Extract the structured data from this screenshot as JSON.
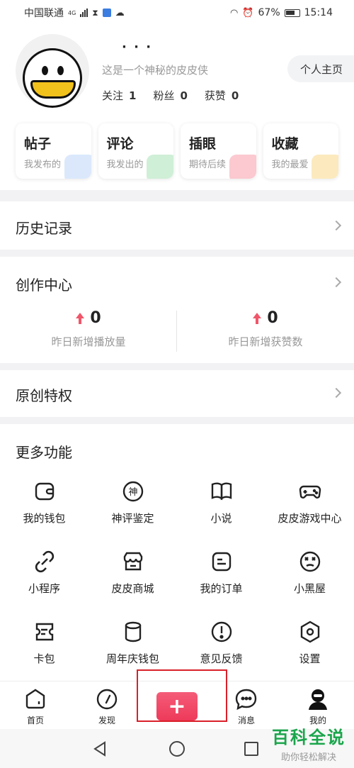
{
  "statusbar": {
    "carrier": "中国联通",
    "network_badge": "4G",
    "battery_pct": "67%",
    "time": "15:14"
  },
  "profile": {
    "nickname": "· · ·",
    "bio": "这是一个神秘的皮皮侠",
    "home_button": "个人主页",
    "stats": [
      {
        "label": "关注",
        "value": "1"
      },
      {
        "label": "粉丝",
        "value": "0"
      },
      {
        "label": "获赞",
        "value": "0"
      }
    ],
    "cards": [
      {
        "title": "帖子",
        "sub": "我发布的",
        "deco_color": "#cfe0fb"
      },
      {
        "title": "评论",
        "sub": "我发出的",
        "deco_color": "#bfeac9"
      },
      {
        "title": "插眼",
        "sub": "期待后续",
        "deco_color": "#f9b7bf"
      },
      {
        "title": "收藏",
        "sub": "我的最爱",
        "deco_color": "#fbe3a8"
      }
    ]
  },
  "history": {
    "title": "历史记录"
  },
  "creator": {
    "title": "创作中心",
    "metrics": [
      {
        "value": "0",
        "label": "昨日新增播放量"
      },
      {
        "value": "0",
        "label": "昨日新增获赞数"
      }
    ]
  },
  "original": {
    "title": "原创特权"
  },
  "more": {
    "title": "更多功能",
    "items": [
      {
        "label": "我的钱包",
        "icon": "wallet-icon"
      },
      {
        "label": "神评鉴定",
        "icon": "shen-badge-icon"
      },
      {
        "label": "小说",
        "icon": "book-icon"
      },
      {
        "label": "皮皮游戏中心",
        "icon": "gamepad-icon"
      },
      {
        "label": "小程序",
        "icon": "link-icon"
      },
      {
        "label": "皮皮商城",
        "icon": "store-icon"
      },
      {
        "label": "我的订单",
        "icon": "order-icon"
      },
      {
        "label": "小黑屋",
        "icon": "dizzy-face-icon"
      },
      {
        "label": "卡包",
        "icon": "card-pack-icon"
      },
      {
        "label": "周年庆钱包",
        "icon": "cylinder-wallet-icon"
      },
      {
        "label": "意见反馈",
        "icon": "feedback-icon"
      },
      {
        "label": "设置",
        "icon": "settings-icon"
      }
    ]
  },
  "bottomnav": {
    "home": "首页",
    "discover": "发现",
    "post_symbol": "+",
    "messages": "消息",
    "mine": "我的"
  },
  "watermark": {
    "title": "百科全说",
    "sub": "助你轻松解决"
  },
  "colors": {
    "accent": "#f0566a",
    "post_button": "#ee3a5a",
    "highlight_box": "#d9202a"
  }
}
